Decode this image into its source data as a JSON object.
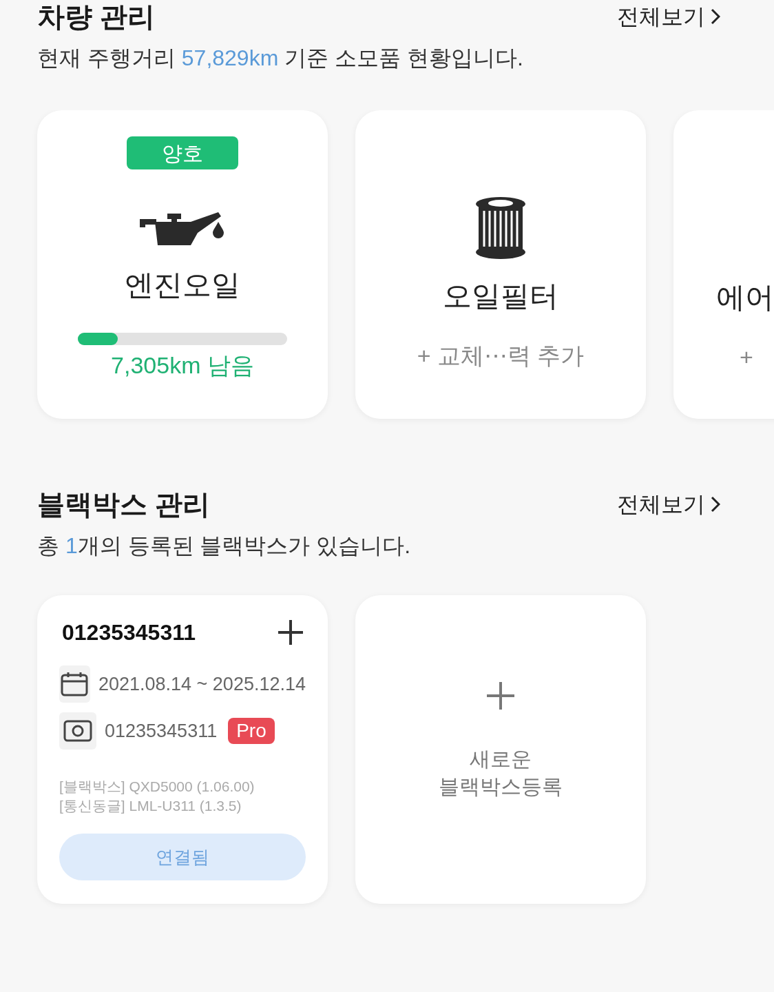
{
  "vehicle": {
    "title": "차량 관리",
    "view_all": "전체보기",
    "summary": {
      "before": "현재 주행거리 ",
      "highlight": "57,829km",
      "after": " 기준 소모품 현황입니다."
    },
    "items": [
      {
        "kind": "gauge",
        "status": "양호",
        "name": "엔진오일",
        "level": 0.19,
        "reading": "7,305km 남음"
      },
      {
        "kind": "add",
        "name": "오일필터",
        "action": "+ 교체⋯력 추가"
      },
      {
        "kind": "partial",
        "name": "에어",
        "action": "+"
      }
    ]
  },
  "blackbox": {
    "title": "블랙박스 관리",
    "view_all": "전체보기",
    "summary": {
      "before": "총 ",
      "highlight": "1",
      "after": "개의 등록된 블랙박스가 있습니다."
    },
    "devices": [
      {
        "serial": "01235345311",
        "period": "2021.08.14 ~ 2025.12.14",
        "camera_id": "01235345311",
        "badge": "Pro",
        "firmware": [
          "[블랙박스] QXD5000 (1.06.00)",
          "[통신동글] LML-U311 (1.3.5)"
        ],
        "connected": true,
        "status": "연결됨"
      }
    ],
    "add_card": {
      "lines": [
        "새로운",
        "블랙박스등록"
      ]
    }
  }
}
